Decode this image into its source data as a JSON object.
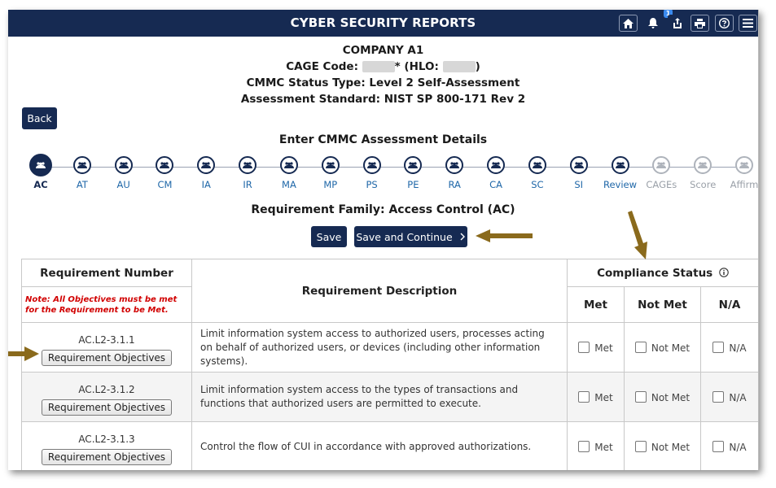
{
  "app": {
    "title": "CYBER SECURITY REPORTS",
    "notification_count": "1"
  },
  "toolbar_icons": [
    "home-icon",
    "bell-icon",
    "share-icon",
    "print-icon",
    "help-icon",
    "menu-icon"
  ],
  "company": {
    "name": "COMPANY A1",
    "cage_prefix": "CAGE Code:",
    "cage_mid": "* (HLO:",
    "cage_suffix": ")",
    "status_line": "CMMC Status Type: Level 2 Self-Assessment",
    "standard_line": "Assessment Standard: NIST SP 800-171 Rev 2"
  },
  "back_label": "Back",
  "section_title": "Enter CMMC Assessment Details",
  "steps": [
    "AC",
    "AT",
    "AU",
    "CM",
    "IA",
    "IR",
    "MA",
    "MP",
    "PS",
    "PE",
    "RA",
    "CA",
    "SC",
    "SI",
    "Review",
    "CAGEs",
    "Score",
    "Affirm"
  ],
  "family_title": "Requirement Family: Access Control (AC)",
  "save_label": "Save",
  "save_continue_label": "Save and Continue",
  "table": {
    "col_req_number": "Requirement Number",
    "col_desc": "Requirement Description",
    "col_compliance": "Compliance Status",
    "note": "Note: All Objectives must be met for the Requirement to be Met.",
    "sub_met": "Met",
    "sub_not_met": "Not Met",
    "sub_na": "N/A",
    "objectives_label": "Requirement Objectives",
    "rows": [
      {
        "number": "AC.L2-3.1.1",
        "description": "Limit information system access to authorized users, processes acting on behalf of authorized users, or devices (including other information systems)."
      },
      {
        "number": "AC.L2-3.1.2",
        "description": "Limit information system access to the types of transactions and functions that authorized users are permitted to execute."
      },
      {
        "number": "AC.L2-3.1.3",
        "description": "Control the flow of CUI in accordance with approved authorizations."
      }
    ],
    "option_met": "Met",
    "option_not_met": "Not Met",
    "option_na": "N/A"
  },
  "colors": {
    "navy": "#162a52",
    "link": "#1f67a8",
    "arrow": "#8a6a1c",
    "note_red": "#d10000"
  }
}
